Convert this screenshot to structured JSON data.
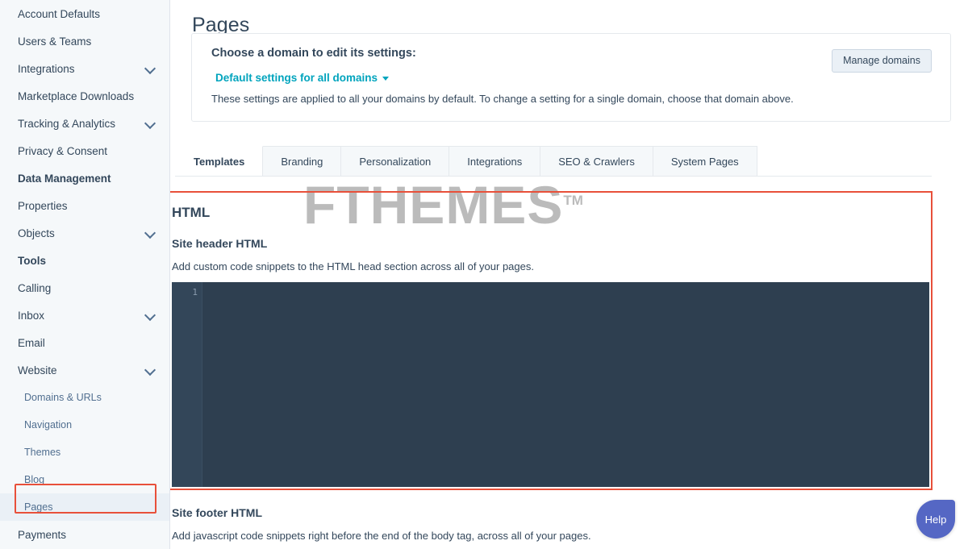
{
  "sidebar": {
    "items": [
      {
        "label": "Account Defaults",
        "type": "item",
        "chevron": false
      },
      {
        "label": "Users & Teams",
        "type": "item",
        "chevron": false
      },
      {
        "label": "Integrations",
        "type": "item",
        "chevron": true
      },
      {
        "label": "Marketplace Downloads",
        "type": "item",
        "chevron": false
      },
      {
        "label": "Tracking & Analytics",
        "type": "item",
        "chevron": true
      },
      {
        "label": "Privacy & Consent",
        "type": "item",
        "chevron": false
      },
      {
        "label": "Data Management",
        "type": "section",
        "chevron": false
      },
      {
        "label": "Properties",
        "type": "item",
        "chevron": false
      },
      {
        "label": "Objects",
        "type": "item",
        "chevron": true
      },
      {
        "label": "Tools",
        "type": "section",
        "chevron": false
      },
      {
        "label": "Calling",
        "type": "item",
        "chevron": false
      },
      {
        "label": "Inbox",
        "type": "item",
        "chevron": true
      },
      {
        "label": "Email",
        "type": "item",
        "chevron": false
      },
      {
        "label": "Website",
        "type": "item",
        "chevron": true
      },
      {
        "label": "Domains & URLs",
        "type": "sub",
        "chevron": false
      },
      {
        "label": "Navigation",
        "type": "sub",
        "chevron": false
      },
      {
        "label": "Themes",
        "type": "sub",
        "chevron": false
      },
      {
        "label": "Blog",
        "type": "sub",
        "chevron": false
      },
      {
        "label": "Pages",
        "type": "sub",
        "chevron": false,
        "selected": true
      },
      {
        "label": "Payments",
        "type": "item",
        "chevron": false
      }
    ]
  },
  "header": {
    "title": "Pages"
  },
  "domain_card": {
    "heading": "Choose a domain to edit its settings:",
    "selected_domain": "Default settings for all domains",
    "description": "These settings are applied to all your domains by default. To change a setting for a single domain, choose that domain above.",
    "manage_button": "Manage domains"
  },
  "tabs": [
    {
      "label": "Templates",
      "active": true
    },
    {
      "label": "Branding",
      "active": false
    },
    {
      "label": "Personalization",
      "active": false
    },
    {
      "label": "Integrations",
      "active": false
    },
    {
      "label": "SEO & Crawlers",
      "active": false
    },
    {
      "label": "System Pages",
      "active": false
    }
  ],
  "watermark": {
    "text": "FTHEMES",
    "trademark": "TM"
  },
  "html_section": {
    "heading": "HTML",
    "site_header_label": "Site header HTML",
    "site_header_description": "Add custom code snippets to the HTML head section across all of your pages.",
    "editor_line_number": "1",
    "editor_value": "",
    "site_footer_label": "Site footer HTML",
    "site_footer_description": "Add javascript code snippets right before the end of the body tag, across all of your pages."
  },
  "help": {
    "label": "Help"
  },
  "colors": {
    "accent_teal": "#00a4bd",
    "text_primary": "#33475b",
    "sidebar_bg": "#f5f8fa",
    "highlight_red": "#e8503a",
    "editor_bg": "#2e3f50",
    "help_purple": "#5567c4"
  }
}
